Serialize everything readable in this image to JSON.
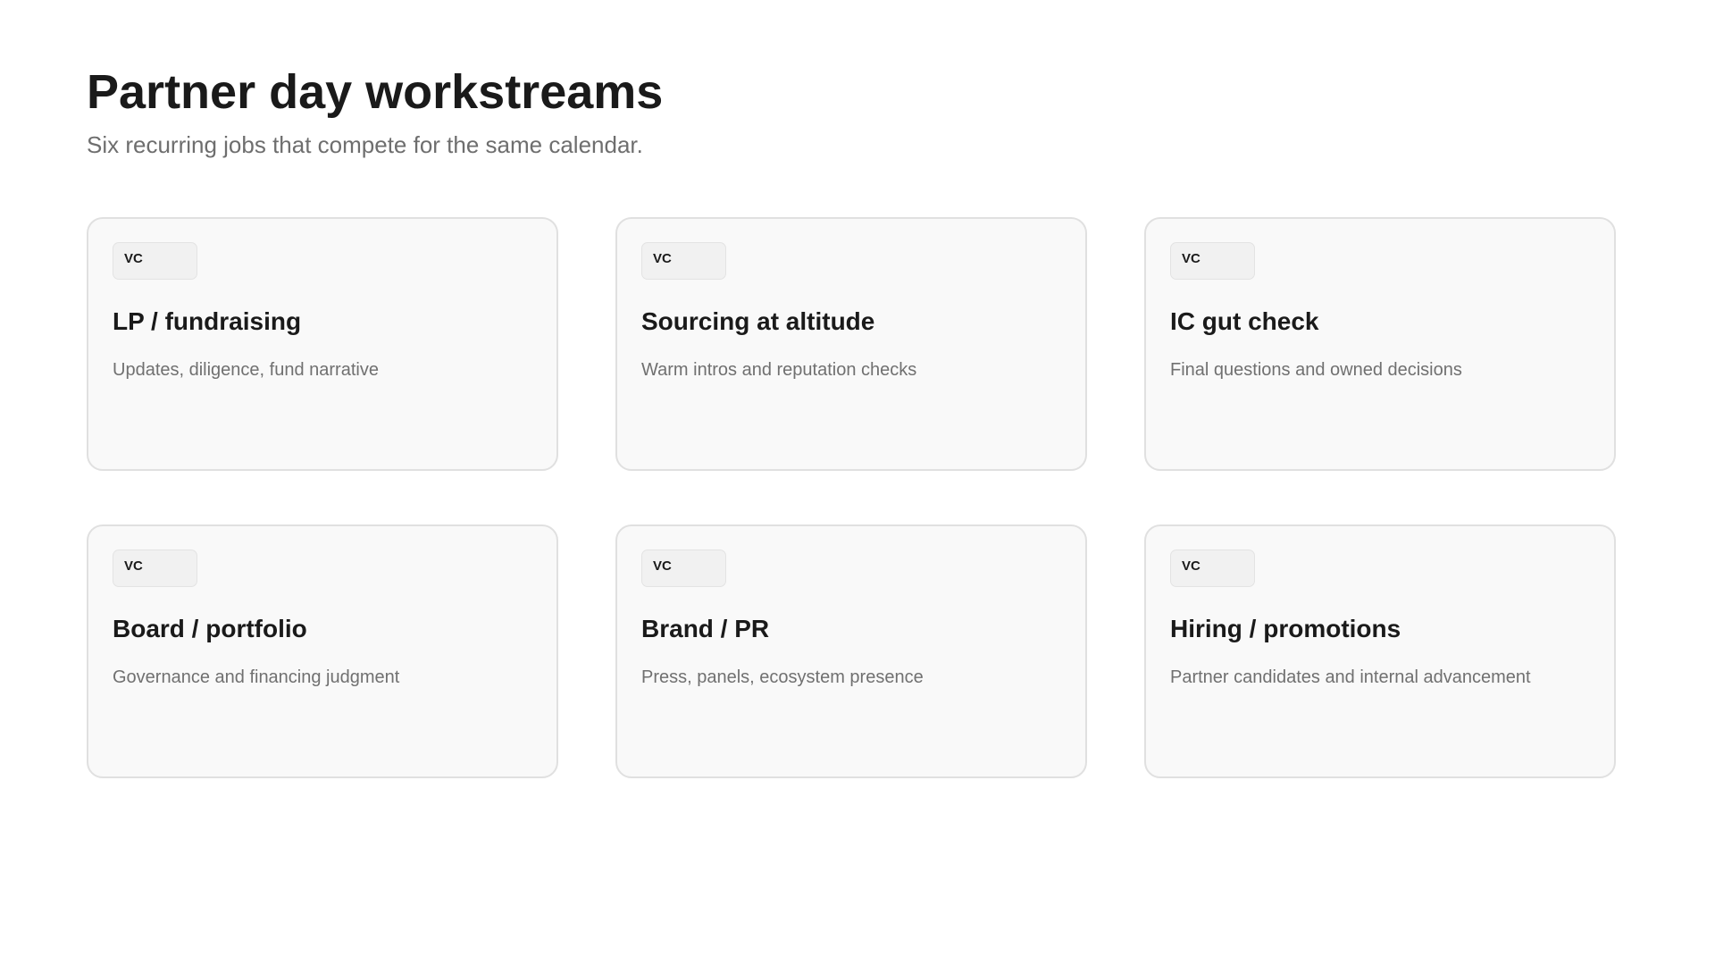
{
  "header": {
    "title": "Partner day workstreams",
    "subtitle": "Six recurring jobs that compete for the same calendar."
  },
  "cards": [
    {
      "tag": "VC",
      "title": "LP / fundraising",
      "description": "Updates, diligence, fund narrative"
    },
    {
      "tag": "VC",
      "title": "Sourcing at altitude",
      "description": "Warm intros and reputation checks"
    },
    {
      "tag": "VC",
      "title": "IC gut check",
      "description": "Final questions and owned decisions"
    },
    {
      "tag": "VC",
      "title": "Board / portfolio",
      "description": "Governance and financing judgment"
    },
    {
      "tag": "VC",
      "title": "Brand / PR",
      "description": "Press, panels, ecosystem presence"
    },
    {
      "tag": "VC",
      "title": "Hiring / promotions",
      "description": "Partner candidates and internal advancement"
    }
  ],
  "colors": {
    "background": "#ffffff",
    "card_background": "#f9f9f9",
    "card_border": "#e0e0e0",
    "title_text": "#1a1a1a",
    "muted_text": "#6e6e6e"
  }
}
